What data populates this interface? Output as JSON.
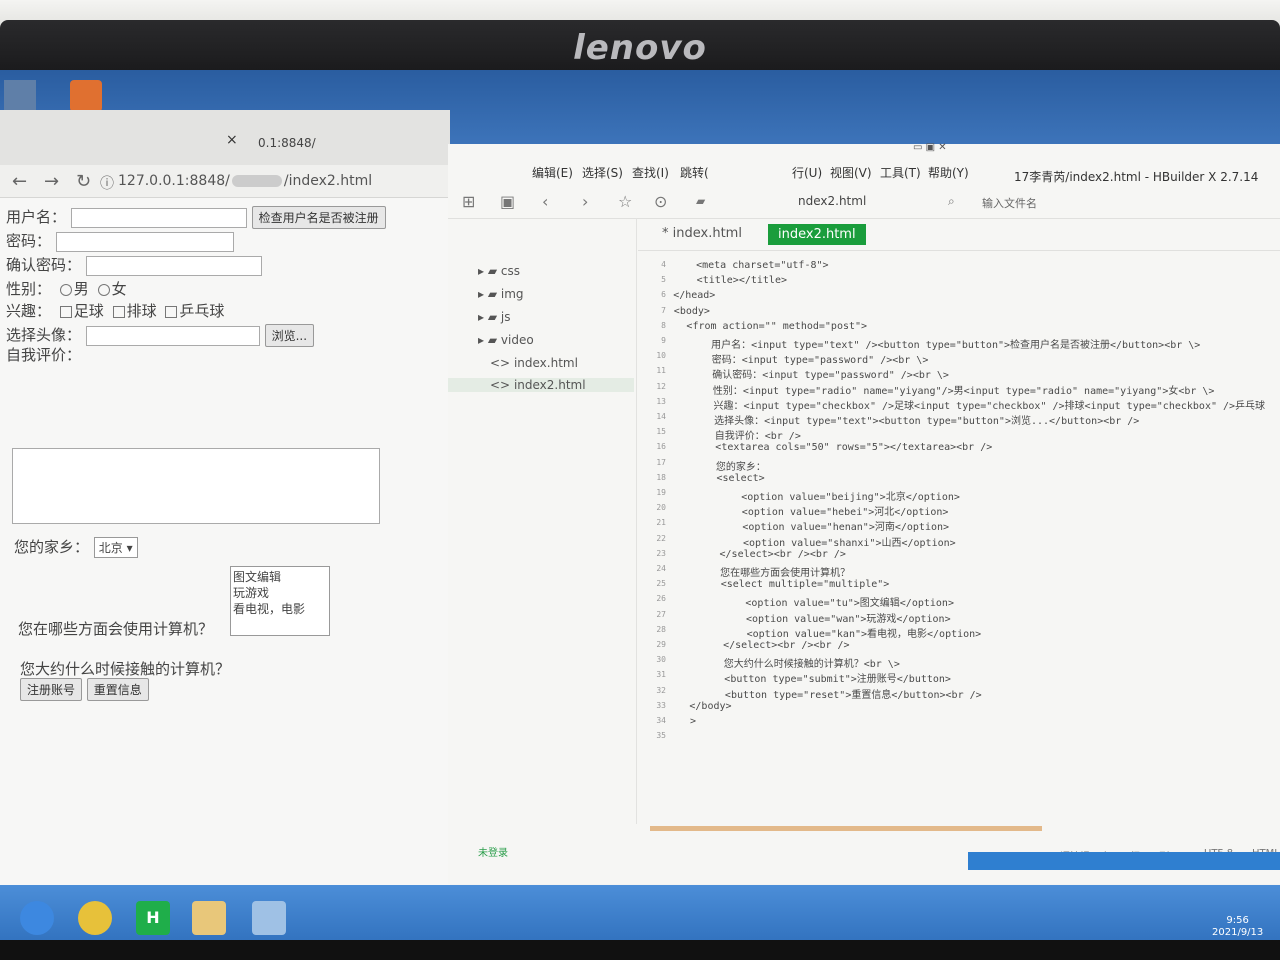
{
  "monitor": {
    "brand": "lenovo"
  },
  "browser": {
    "tab_close": "×",
    "tab2_text": "0.1:8848/",
    "url": "127.0.0.1:8848/",
    "url_tail": "/index2.html",
    "form": {
      "username_label": "用户名：",
      "check_button": "检查用户名是否被注册",
      "password_label": "密码：",
      "confirm_label": "确认密码：",
      "gender_label": "性别：",
      "gender_options": [
        "男",
        "女"
      ],
      "hobby_label": "兴趣：",
      "hobby_options": [
        "足球",
        "排球",
        "乒乓球"
      ],
      "avatar_label": "选择头像：",
      "browse_button": "浏览...",
      "review_label": "自我评价：",
      "hometown_label": "您的家乡：",
      "hometown_selected": "北京",
      "usage_label": "您在哪些方面会使用计算机？",
      "usage_options": [
        "图文编辑",
        "玩游戏",
        "看电视，电影"
      ],
      "when_label": "您大约什么时候接触的计算机？",
      "submit_button": "注册账号",
      "reset_button": "重置信息"
    }
  },
  "editor": {
    "menus": [
      "编辑(E)",
      "选择(S)",
      "查找(I)",
      "跳转(",
      "行(U)",
      "视图(V)",
      "工具(T)",
      "帮助(Y)"
    ],
    "title": "17李青芮/index2.html - HBuilder X 2.7.14",
    "breadcrumb": "ndex2.html",
    "search_placeholder": "输入文件名",
    "tree": [
      "css",
      "img",
      "js",
      "video",
      "index.html",
      "index2.html"
    ],
    "file_tabs": [
      "* index.html",
      "index2.html"
    ],
    "code_lines": [
      {
        "n": "4",
        "t": "    <meta charset=\"utf-8\">"
      },
      {
        "n": "5",
        "t": "    <title></title>"
      },
      {
        "n": "6",
        "t": "</head>"
      },
      {
        "n": "7",
        "t": "<body>"
      },
      {
        "n": "8",
        "t": "  <from action=\"\" method=\"post\">"
      },
      {
        "n": "9",
        "t": "      用户名：<input type=\"text\" /><button type=\"button\">检查用户名是否被注册</button><br \\>"
      },
      {
        "n": "10",
        "t": "      密码：<input type=\"password\" /><br \\>"
      },
      {
        "n": "11",
        "t": "      确认密码：<input type=\"password\" /><br \\>"
      },
      {
        "n": "12",
        "t": "      性别：<input type=\"radio\" name=\"yiyang\"/>男<input type=\"radio\" name=\"yiyang\">女<br \\>"
      },
      {
        "n": "13",
        "t": "      兴趣：<input type=\"checkbox\" />足球<input type=\"checkbox\" />排球<input type=\"checkbox\" />乒乓球"
      },
      {
        "n": "14",
        "t": "      选择头像：<input type=\"text\"><button type=\"button\">浏览...</button><br />"
      },
      {
        "n": "15",
        "t": "      自我评价：<br />"
      },
      {
        "n": "16",
        "t": "      <textarea cols=\"50\" rows=\"5\"></textarea><br />"
      },
      {
        "n": "17",
        "t": "      您的家乡："
      },
      {
        "n": "18",
        "t": "      <select>"
      },
      {
        "n": "19",
        "t": "          <option value=\"beijing\">北京</option>"
      },
      {
        "n": "20",
        "t": "          <option value=\"hebei\">河北</option>"
      },
      {
        "n": "21",
        "t": "          <option value=\"henan\">河南</option>"
      },
      {
        "n": "22",
        "t": "          <option value=\"shanxi\">山西</option>"
      },
      {
        "n": "23",
        "t": "      </select><br /><br />"
      },
      {
        "n": "24",
        "t": "      您在哪些方面会使用计算机？"
      },
      {
        "n": "25",
        "t": "      <select multiple=\"multiple\">"
      },
      {
        "n": "26",
        "t": "          <option value=\"tu\">图文编辑</option>"
      },
      {
        "n": "27",
        "t": "          <option value=\"wan\">玩游戏</option>"
      },
      {
        "n": "28",
        "t": "          <option value=\"kan\">看电视，电影</option>"
      },
      {
        "n": "29",
        "t": "      </select><br /><br />"
      },
      {
        "n": "30",
        "t": "      您大约什么时候接触的计算机？<br \\>"
      },
      {
        "n": "31",
        "t": "      <button type=\"submit\">注册账号</button>"
      },
      {
        "n": "32",
        "t": "      <button type=\"reset\">重置信息</button><br />"
      },
      {
        "n": "33",
        "t": "</body>"
      },
      {
        "n": "34",
        "t": ">"
      },
      {
        "n": "35",
        "t": ""
      }
    ],
    "status": {
      "login": "未登录",
      "hint": "语法提示库",
      "position": "行:35  列:1",
      "encoding": "UTF-8",
      "lang": "HTML"
    }
  },
  "taskbar": {
    "time": "9:56",
    "date": "2021/9/13"
  },
  "colors": {
    "accent_green": "#1a9d3c",
    "taskbar_blue": "#2c6cb9"
  }
}
